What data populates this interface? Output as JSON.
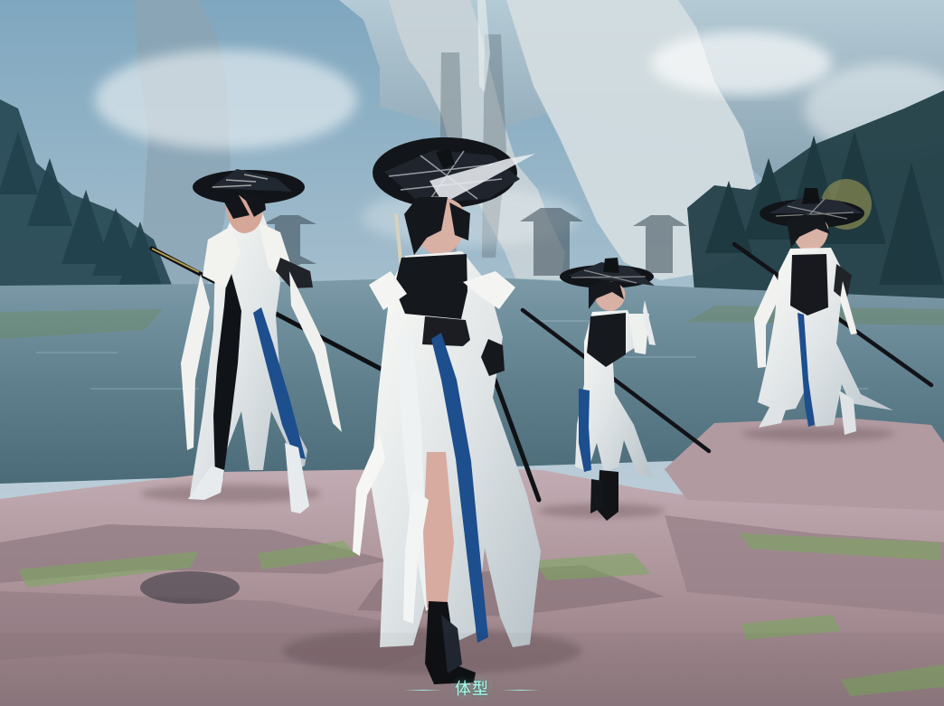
{
  "bottom_label": {
    "text": "体型"
  },
  "colors": {
    "label_text": "#a8fff0",
    "robe_white": "#eef0ec",
    "accent_blue": "#1d4e8d",
    "dark_hat": "#111419",
    "water": "#5f7e8d",
    "rock": "#a98f96"
  },
  "icons": {
    "characters": [
      "character",
      "character",
      "character",
      "character"
    ],
    "weapons": [
      "spear",
      "spear",
      "spear"
    ]
  }
}
